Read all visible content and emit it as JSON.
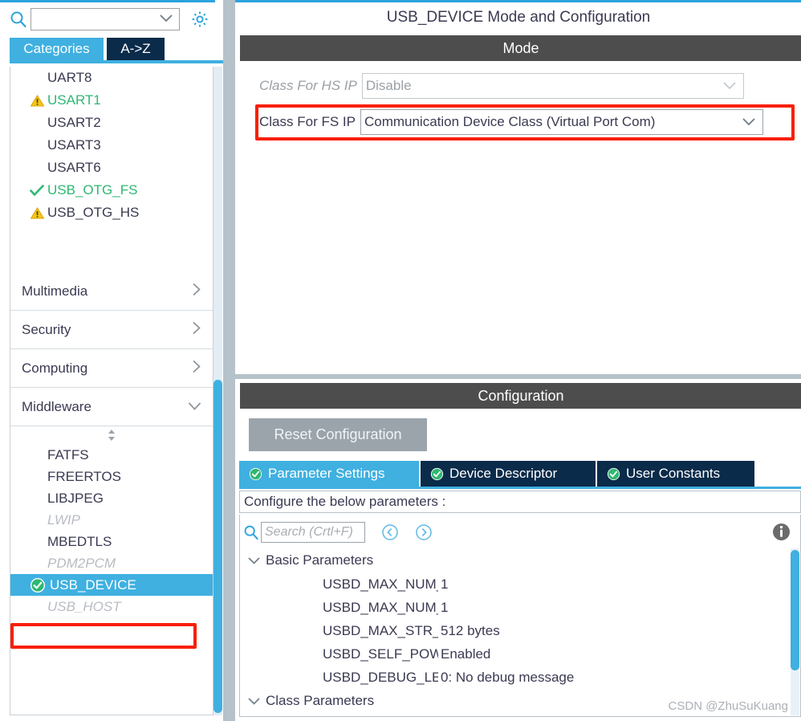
{
  "left": {
    "search": {
      "value": "",
      "placeholder": ""
    },
    "gear_icon": "gear-icon",
    "search_icon": "search-icon",
    "tabs": [
      {
        "label": "Categories",
        "active": true
      },
      {
        "label": "A->Z",
        "active": false
      }
    ],
    "peripherals": [
      {
        "label": "UART8",
        "status": "none",
        "color": "dark"
      },
      {
        "label": "USART1",
        "status": "warning",
        "color": "green"
      },
      {
        "label": "USART2",
        "status": "none",
        "color": "dark"
      },
      {
        "label": "USART3",
        "status": "none",
        "color": "dark"
      },
      {
        "label": "USART6",
        "status": "none",
        "color": "dark"
      },
      {
        "label": "USB_OTG_FS",
        "status": "check",
        "color": "green"
      },
      {
        "label": "USB_OTG_HS",
        "status": "warning",
        "color": "dark"
      }
    ],
    "categories": [
      {
        "label": "Multimedia",
        "expanded": false,
        "arrow": "chevron-right-icon"
      },
      {
        "label": "Security",
        "expanded": false,
        "arrow": "chevron-right-icon"
      },
      {
        "label": "Computing",
        "expanded": false,
        "arrow": "chevron-right-icon"
      },
      {
        "label": "Middleware",
        "expanded": true,
        "arrow": "chevron-down-icon"
      }
    ],
    "middleware": [
      {
        "label": "FATFS",
        "state": "normal"
      },
      {
        "label": "FREERTOS",
        "state": "normal"
      },
      {
        "label": "LIBJPEG",
        "state": "normal"
      },
      {
        "label": "LWIP",
        "state": "disabled"
      },
      {
        "label": "MBEDTLS",
        "state": "normal"
      },
      {
        "label": "PDM2PCM",
        "state": "disabled"
      },
      {
        "label": "USB_DEVICE",
        "state": "selected"
      },
      {
        "label": "USB_HOST",
        "state": "disabled"
      }
    ]
  },
  "mode": {
    "pane_title": "USB_DEVICE Mode and Configuration",
    "section_label": "Mode",
    "fields": [
      {
        "label": "Class For HS IP",
        "value": "Disable",
        "disabled": true
      },
      {
        "label": "Class For FS IP",
        "value": "Communication Device Class (Virtual Port Com)",
        "disabled": false
      }
    ]
  },
  "configuration": {
    "section_label": "Configuration",
    "reset_label": "Reset Configuration",
    "tabs": [
      {
        "label": "Parameter Settings",
        "active": true,
        "icon": "check-circle-icon"
      },
      {
        "label": "Device Descriptor",
        "active": false,
        "icon": "check-circle-icon"
      },
      {
        "label": "User Constants",
        "active": false,
        "icon": "check-circle-icon"
      }
    ],
    "hint": "Configure the below parameters :",
    "search": {
      "value": "",
      "placeholder": "Search (Crtl+F)"
    },
    "nav_prev_icon": "chevron-left-circle-icon",
    "nav_next_icon": "chevron-right-circle-icon",
    "info_icon": "info-icon",
    "tree": [
      {
        "group": "Basic Parameters",
        "expanded": true,
        "rows": [
          {
            "name": "USBD_MAX_NUM_INTE...",
            "value": "1"
          },
          {
            "name": "USBD_MAX_NUM_CONF...",
            "value": "1"
          },
          {
            "name": "USBD_MAX_STR_DESC...",
            "value": "512 bytes"
          },
          {
            "name": "USBD_SELF_POWERE...",
            "value": "Enabled"
          },
          {
            "name": "USBD_DEBUG_LEVEL (...",
            "value": "0: No debug message"
          }
        ]
      },
      {
        "group": "Class Parameters",
        "expanded": true,
        "rows": []
      }
    ]
  },
  "watermark": "CSDN @ZhuSuKuang",
  "colors": {
    "accent_blue": "#3fb0e0",
    "tab_dark": "#0b2b4a",
    "section_gray": "#4d4d4d",
    "highlight_red": "#f91f08",
    "ok_green": "#2eb872",
    "warn_yellow": "#f5c518"
  }
}
